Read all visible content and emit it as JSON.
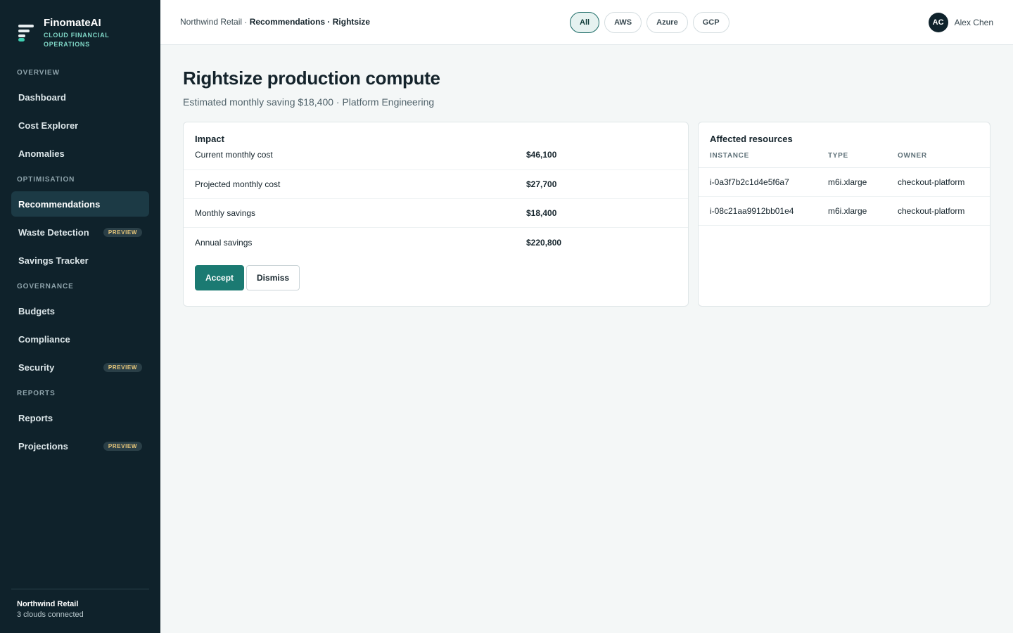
{
  "brand": {
    "name": "FinomateAI",
    "tagline": "CLOUD FINANCIAL OPERATIONS"
  },
  "sidebar": {
    "sections": [
      {
        "label": "OVERVIEW",
        "items": [
          {
            "label": "Dashboard"
          },
          {
            "label": "Cost Explorer"
          },
          {
            "label": "Anomalies"
          }
        ]
      },
      {
        "label": "OPTIMISATION",
        "items": [
          {
            "label": "Recommendations",
            "active": true
          },
          {
            "label": "Waste Detection",
            "badge": "PREVIEW"
          },
          {
            "label": "Savings Tracker"
          }
        ]
      },
      {
        "label": "GOVERNANCE",
        "items": [
          {
            "label": "Budgets"
          },
          {
            "label": "Compliance"
          },
          {
            "label": "Security",
            "badge": "PREVIEW"
          }
        ]
      },
      {
        "label": "REPORTS",
        "items": [
          {
            "label": "Reports"
          },
          {
            "label": "Projections",
            "badge": "PREVIEW"
          }
        ]
      }
    ],
    "footer": {
      "org": "Northwind Retail",
      "status": "3 clouds connected"
    }
  },
  "header": {
    "breadcrumb": {
      "org": "Northwind Retail",
      "separator": " · ",
      "current": "Recommendations · Rightsize"
    },
    "cloud_filters": [
      {
        "label": "All",
        "active": true
      },
      {
        "label": "AWS"
      },
      {
        "label": "Azure"
      },
      {
        "label": "GCP"
      }
    ],
    "user": {
      "initials": "AC",
      "name": "Alex Chen"
    }
  },
  "page": {
    "title": "Rightsize production compute",
    "subtitle": "Estimated monthly saving $18,400 · Platform Engineering"
  },
  "impact": {
    "title": "Impact",
    "rows": [
      {
        "label": "Current monthly cost",
        "value": "$46,100"
      },
      {
        "label": "Projected monthly cost",
        "value": "$27,700"
      },
      {
        "label": "Monthly savings",
        "value": "$18,400"
      },
      {
        "label": "Annual savings",
        "value": "$220,800"
      }
    ],
    "accept_label": "Accept",
    "dismiss_label": "Dismiss"
  },
  "resources": {
    "title": "Affected resources",
    "columns": [
      "INSTANCE",
      "TYPE",
      "OWNER"
    ],
    "rows": [
      [
        "i-0a3f7b2c1d4e5f6a7",
        "m6i.xlarge",
        "checkout-platform"
      ],
      [
        "i-08c21aa9912bb01e4",
        "m6i.xlarge",
        "checkout-platform"
      ]
    ]
  },
  "colors": {
    "sidebar_bg": "#0f222b",
    "accent": "#1b7a72",
    "brand_accent": "#3fd0b2",
    "badge_text": "#e8c77a"
  }
}
